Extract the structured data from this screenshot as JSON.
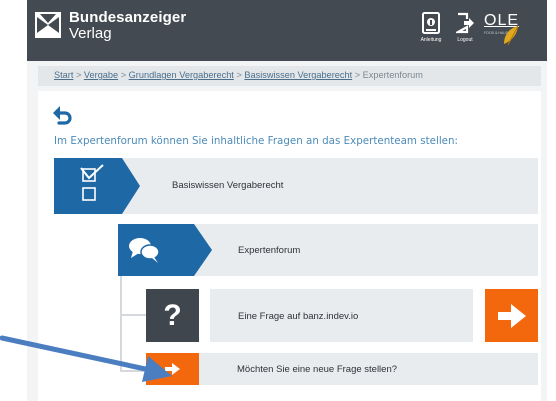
{
  "header": {
    "brand_line1": "Bundesanzeiger",
    "brand_line2": "Verlag",
    "anleitung_label": "Anleitung",
    "logout_label": "Logout",
    "ole_label": "OLE",
    "ole_sub": "FOOD & HAUS"
  },
  "breadcrumb": {
    "items": [
      "Start",
      "Vergabe",
      "Grundlagen Vergaberecht",
      "Basiswissen Vergaberecht"
    ],
    "current": "Expertenforum",
    "separator": ">"
  },
  "intro": "Im Expertenforum können Sie inhaltliche Fragen an das Expertenteam stellen:",
  "rows": {
    "basiswissen": {
      "label": "Basiswissen Vergaberecht",
      "icon": "checklist-icon"
    },
    "expertenforum": {
      "label": "Expertenforum",
      "icon": "chat-bubbles-icon"
    },
    "frage": {
      "label": "Eine Frage auf banz.indev.io",
      "icon": "question-mark-icon",
      "glyph": "?"
    },
    "neue_frage": {
      "label": "Möchten Sie eine neue Frage stellen?",
      "icon": "arrow-right-icon"
    }
  },
  "colors": {
    "header_bg": "#444a51",
    "accent_blue": "#1f68a6",
    "accent_orange": "#f3670d",
    "dark_tile": "#3f464e",
    "link": "#4a6f8c",
    "intro_text": "#4d8bb9",
    "annotation_arrow": "#4b7ec0"
  }
}
